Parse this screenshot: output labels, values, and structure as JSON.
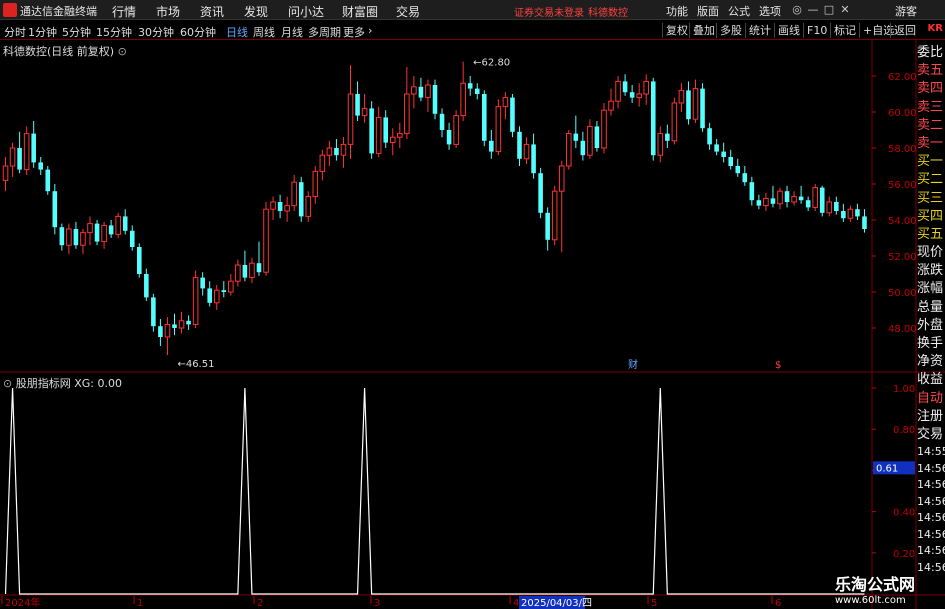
{
  "menubar": {
    "app_title": "通达信金融终端",
    "menus": [
      "行情",
      "市场",
      "资讯",
      "发现",
      "问小达",
      "财富圈",
      "交易"
    ],
    "status_login": "证券交易未登录",
    "status_stock": "科德数控",
    "right_menus": [
      "功能",
      "版面",
      "公式",
      "选项"
    ],
    "guest": "游客",
    "win_buttons": [
      "◎",
      "—",
      "□",
      "✕"
    ]
  },
  "tabs": {
    "items": [
      "分时",
      "1分钟",
      "5分钟",
      "15分钟",
      "30分钟",
      "60分钟",
      "日线",
      "周线",
      "月线",
      "多周期",
      "更多"
    ],
    "active": "日线",
    "more_arrow": "›",
    "right_buttons": [
      "复权",
      "叠加",
      "多股",
      "统计",
      "画线",
      "F10",
      "标记",
      "+自选",
      "返回"
    ],
    "kr": "KR"
  },
  "main_chart": {
    "title": "科德数控(日线 前复权)",
    "y_ticks": [
      "62.00",
      "60.00",
      "58.00",
      "56.00",
      "54.00",
      "52.00",
      "50.00",
      "48.00"
    ],
    "high_label": "62.80",
    "low_label": "46.51",
    "marker_cai": "财",
    "marker_dollar": "$"
  },
  "indicator": {
    "title": "股朋指标网 XG: 0.00",
    "y_ticks": [
      "1.00",
      "0.80",
      "0.60",
      "0.40",
      "0.20"
    ],
    "current_value": "0.61"
  },
  "x_axis": {
    "labels": [
      "2024年",
      "1",
      "2",
      "3",
      "4",
      "5",
      "6"
    ],
    "highlight_date": "2025/04/03/四"
  },
  "side_list": {
    "items": [
      "委比",
      "卖五",
      "卖四",
      "卖三",
      "卖二",
      "卖一",
      "买一",
      "买二",
      "买三",
      "买四",
      "买五",
      "现价",
      "涨跌",
      "涨幅",
      "总量",
      "外盘",
      "换手",
      "净资",
      "收益",
      "自动",
      "注册",
      "交易",
      "14:55",
      "14:56",
      "14:56",
      "14:56",
      "14:56",
      "14:56",
      "14:56",
      "14:56"
    ]
  },
  "watermark": {
    "line1": "乐淘公式网",
    "line2": "www.60lt.com"
  },
  "chart_data": {
    "type": "candlestick",
    "y_range": [
      46.5,
      63.0
    ],
    "candles": [
      {
        "o": 56.2,
        "h": 57.5,
        "l": 55.6,
        "c": 57.0
      },
      {
        "o": 57.0,
        "h": 58.3,
        "l": 56.4,
        "c": 58.0
      },
      {
        "o": 58.0,
        "h": 58.9,
        "l": 56.6,
        "c": 56.8
      },
      {
        "o": 56.8,
        "h": 59.2,
        "l": 56.5,
        "c": 58.8
      },
      {
        "o": 58.8,
        "h": 59.5,
        "l": 56.9,
        "c": 57.2
      },
      {
        "o": 57.2,
        "h": 57.5,
        "l": 56.5,
        "c": 56.8
      },
      {
        "o": 56.8,
        "h": 57.0,
        "l": 55.4,
        "c": 55.6
      },
      {
        "o": 55.6,
        "h": 56.0,
        "l": 53.2,
        "c": 53.6
      },
      {
        "o": 53.6,
        "h": 53.8,
        "l": 52.3,
        "c": 52.6
      },
      {
        "o": 52.6,
        "h": 53.8,
        "l": 52.1,
        "c": 53.5
      },
      {
        "o": 53.5,
        "h": 53.9,
        "l": 52.4,
        "c": 52.6
      },
      {
        "o": 52.6,
        "h": 53.5,
        "l": 52.1,
        "c": 53.3
      },
      {
        "o": 53.3,
        "h": 54.2,
        "l": 52.6,
        "c": 53.8
      },
      {
        "o": 53.8,
        "h": 54.0,
        "l": 52.6,
        "c": 52.8
      },
      {
        "o": 52.8,
        "h": 53.9,
        "l": 52.4,
        "c": 53.7
      },
      {
        "o": 53.7,
        "h": 54.0,
        "l": 53.0,
        "c": 53.2
      },
      {
        "o": 53.2,
        "h": 54.4,
        "l": 53.0,
        "c": 54.2
      },
      {
        "o": 54.2,
        "h": 54.6,
        "l": 53.2,
        "c": 53.4
      },
      {
        "o": 53.4,
        "h": 53.7,
        "l": 52.3,
        "c": 52.5
      },
      {
        "o": 52.5,
        "h": 52.7,
        "l": 50.8,
        "c": 51.0
      },
      {
        "o": 51.0,
        "h": 51.3,
        "l": 49.5,
        "c": 49.7
      },
      {
        "o": 49.7,
        "h": 49.9,
        "l": 47.8,
        "c": 48.1
      },
      {
        "o": 48.1,
        "h": 48.5,
        "l": 47.0,
        "c": 47.5
      },
      {
        "o": 47.5,
        "h": 48.6,
        "l": 46.5,
        "c": 48.2
      },
      {
        "o": 48.2,
        "h": 48.8,
        "l": 47.6,
        "c": 48.0
      },
      {
        "o": 48.0,
        "h": 48.9,
        "l": 47.7,
        "c": 48.4
      },
      {
        "o": 48.4,
        "h": 48.7,
        "l": 47.9,
        "c": 48.2
      },
      {
        "o": 48.2,
        "h": 51.2,
        "l": 48.0,
        "c": 50.8
      },
      {
        "o": 50.8,
        "h": 51.1,
        "l": 49.8,
        "c": 50.2
      },
      {
        "o": 50.2,
        "h": 50.6,
        "l": 49.2,
        "c": 49.4
      },
      {
        "o": 49.4,
        "h": 50.4,
        "l": 49.0,
        "c": 50.1
      },
      {
        "o": 50.1,
        "h": 50.6,
        "l": 49.7,
        "c": 50.0
      },
      {
        "o": 50.0,
        "h": 51.0,
        "l": 49.8,
        "c": 50.6
      },
      {
        "o": 50.6,
        "h": 51.8,
        "l": 50.3,
        "c": 51.5
      },
      {
        "o": 51.5,
        "h": 52.3,
        "l": 50.6,
        "c": 50.8
      },
      {
        "o": 50.8,
        "h": 51.9,
        "l": 50.5,
        "c": 51.6
      },
      {
        "o": 51.6,
        "h": 52.8,
        "l": 50.9,
        "c": 51.1
      },
      {
        "o": 51.1,
        "h": 55.0,
        "l": 50.9,
        "c": 54.6
      },
      {
        "o": 54.6,
        "h": 55.3,
        "l": 54.0,
        "c": 55.0
      },
      {
        "o": 55.0,
        "h": 55.4,
        "l": 54.1,
        "c": 54.5
      },
      {
        "o": 54.5,
        "h": 55.3,
        "l": 53.9,
        "c": 54.8
      },
      {
        "o": 54.8,
        "h": 56.5,
        "l": 54.5,
        "c": 56.1
      },
      {
        "o": 56.1,
        "h": 56.4,
        "l": 53.9,
        "c": 54.2
      },
      {
        "o": 54.2,
        "h": 55.6,
        "l": 53.9,
        "c": 55.3
      },
      {
        "o": 55.3,
        "h": 57.0,
        "l": 54.9,
        "c": 56.7
      },
      {
        "o": 56.7,
        "h": 57.9,
        "l": 56.2,
        "c": 57.6
      },
      {
        "o": 57.6,
        "h": 58.4,
        "l": 57.0,
        "c": 58.0
      },
      {
        "o": 58.0,
        "h": 58.5,
        "l": 57.3,
        "c": 57.6
      },
      {
        "o": 57.6,
        "h": 58.6,
        "l": 56.9,
        "c": 58.2
      },
      {
        "o": 58.2,
        "h": 62.6,
        "l": 57.4,
        "c": 61.0
      },
      {
        "o": 61.0,
        "h": 61.7,
        "l": 59.5,
        "c": 59.8
      },
      {
        "o": 59.8,
        "h": 61.0,
        "l": 59.4,
        "c": 60.2
      },
      {
        "o": 60.2,
        "h": 60.6,
        "l": 57.4,
        "c": 57.7
      },
      {
        "o": 57.7,
        "h": 60.3,
        "l": 57.5,
        "c": 59.7
      },
      {
        "o": 59.7,
        "h": 60.1,
        "l": 58.0,
        "c": 58.3
      },
      {
        "o": 58.3,
        "h": 59.1,
        "l": 57.6,
        "c": 58.6
      },
      {
        "o": 58.6,
        "h": 59.4,
        "l": 58.0,
        "c": 58.8
      },
      {
        "o": 58.8,
        "h": 62.5,
        "l": 58.5,
        "c": 61.0
      },
      {
        "o": 61.0,
        "h": 62.0,
        "l": 60.2,
        "c": 61.4
      },
      {
        "o": 61.4,
        "h": 61.9,
        "l": 60.6,
        "c": 60.8
      },
      {
        "o": 60.8,
        "h": 61.8,
        "l": 60.0,
        "c": 61.5
      },
      {
        "o": 61.5,
        "h": 61.8,
        "l": 59.6,
        "c": 59.9
      },
      {
        "o": 59.9,
        "h": 60.2,
        "l": 58.6,
        "c": 59.0
      },
      {
        "o": 59.0,
        "h": 59.4,
        "l": 57.9,
        "c": 58.2
      },
      {
        "o": 58.2,
        "h": 60.1,
        "l": 58.0,
        "c": 59.8
      },
      {
        "o": 59.8,
        "h": 62.8,
        "l": 59.5,
        "c": 61.6
      },
      {
        "o": 61.6,
        "h": 62.0,
        "l": 60.9,
        "c": 61.3
      },
      {
        "o": 61.3,
        "h": 61.6,
        "l": 60.7,
        "c": 61.0
      },
      {
        "o": 61.0,
        "h": 61.2,
        "l": 58.1,
        "c": 58.4
      },
      {
        "o": 58.4,
        "h": 59.0,
        "l": 57.4,
        "c": 57.8
      },
      {
        "o": 57.8,
        "h": 60.7,
        "l": 57.6,
        "c": 60.3
      },
      {
        "o": 60.3,
        "h": 61.1,
        "l": 59.6,
        "c": 60.8
      },
      {
        "o": 60.8,
        "h": 61.0,
        "l": 58.6,
        "c": 58.9
      },
      {
        "o": 58.9,
        "h": 59.2,
        "l": 57.0,
        "c": 57.4
      },
      {
        "o": 57.4,
        "h": 58.6,
        "l": 57.1,
        "c": 58.2
      },
      {
        "o": 58.2,
        "h": 58.8,
        "l": 56.3,
        "c": 56.6
      },
      {
        "o": 56.6,
        "h": 56.9,
        "l": 54.1,
        "c": 54.4
      },
      {
        "o": 54.4,
        "h": 54.7,
        "l": 52.3,
        "c": 52.9
      },
      {
        "o": 52.9,
        "h": 55.9,
        "l": 52.6,
        "c": 55.6
      },
      {
        "o": 55.6,
        "h": 57.3,
        "l": 52.2,
        "c": 57.0
      },
      {
        "o": 57.0,
        "h": 59.0,
        "l": 56.8,
        "c": 58.8
      },
      {
        "o": 58.8,
        "h": 59.8,
        "l": 58.0,
        "c": 58.4
      },
      {
        "o": 58.4,
        "h": 58.9,
        "l": 57.3,
        "c": 57.6
      },
      {
        "o": 57.6,
        "h": 59.6,
        "l": 57.4,
        "c": 59.2
      },
      {
        "o": 59.2,
        "h": 59.5,
        "l": 57.8,
        "c": 58.0
      },
      {
        "o": 58.0,
        "h": 60.5,
        "l": 57.7,
        "c": 60.1
      },
      {
        "o": 60.1,
        "h": 61.3,
        "l": 59.8,
        "c": 60.6
      },
      {
        "o": 60.6,
        "h": 62.0,
        "l": 60.2,
        "c": 61.7
      },
      {
        "o": 61.7,
        "h": 62.1,
        "l": 60.9,
        "c": 61.1
      },
      {
        "o": 61.1,
        "h": 61.5,
        "l": 60.5,
        "c": 60.8
      },
      {
        "o": 60.8,
        "h": 61.6,
        "l": 60.3,
        "c": 61.0
      },
      {
        "o": 61.0,
        "h": 62.1,
        "l": 60.4,
        "c": 61.7
      },
      {
        "o": 61.7,
        "h": 61.9,
        "l": 57.3,
        "c": 57.6
      },
      {
        "o": 57.6,
        "h": 59.2,
        "l": 57.2,
        "c": 58.8
      },
      {
        "o": 58.8,
        "h": 59.3,
        "l": 58.0,
        "c": 58.4
      },
      {
        "o": 58.4,
        "h": 60.8,
        "l": 58.2,
        "c": 60.5
      },
      {
        "o": 60.5,
        "h": 61.6,
        "l": 60.0,
        "c": 61.2
      },
      {
        "o": 61.2,
        "h": 61.7,
        "l": 59.3,
        "c": 59.6
      },
      {
        "o": 59.6,
        "h": 61.8,
        "l": 59.4,
        "c": 61.3
      },
      {
        "o": 61.3,
        "h": 61.6,
        "l": 58.9,
        "c": 59.1
      },
      {
        "o": 59.1,
        "h": 59.4,
        "l": 57.9,
        "c": 58.2
      },
      {
        "o": 58.2,
        "h": 58.5,
        "l": 57.6,
        "c": 57.8
      },
      {
        "o": 57.8,
        "h": 58.3,
        "l": 57.2,
        "c": 57.5
      },
      {
        "o": 57.5,
        "h": 57.9,
        "l": 56.8,
        "c": 57.0
      },
      {
        "o": 57.0,
        "h": 57.4,
        "l": 56.4,
        "c": 56.6
      },
      {
        "o": 56.6,
        "h": 57.0,
        "l": 55.9,
        "c": 56.1
      },
      {
        "o": 56.1,
        "h": 56.4,
        "l": 54.8,
        "c": 55.1
      },
      {
        "o": 55.1,
        "h": 55.4,
        "l": 54.6,
        "c": 54.8
      },
      {
        "o": 54.8,
        "h": 55.5,
        "l": 54.5,
        "c": 55.2
      },
      {
        "o": 55.2,
        "h": 55.9,
        "l": 54.7,
        "c": 54.9
      },
      {
        "o": 54.9,
        "h": 55.8,
        "l": 54.6,
        "c": 55.6
      },
      {
        "o": 55.6,
        "h": 55.9,
        "l": 54.7,
        "c": 55.0
      },
      {
        "o": 55.0,
        "h": 55.6,
        "l": 54.8,
        "c": 55.3
      },
      {
        "o": 55.3,
        "h": 55.9,
        "l": 54.9,
        "c": 55.1
      },
      {
        "o": 55.1,
        "h": 55.3,
        "l": 54.5,
        "c": 54.7
      },
      {
        "o": 54.7,
        "h": 56.0,
        "l": 54.5,
        "c": 55.8
      },
      {
        "o": 55.8,
        "h": 55.9,
        "l": 54.2,
        "c": 54.4
      },
      {
        "o": 54.4,
        "h": 55.3,
        "l": 54.2,
        "c": 55.0
      },
      {
        "o": 55.0,
        "h": 55.3,
        "l": 54.3,
        "c": 54.5
      },
      {
        "o": 54.5,
        "h": 54.9,
        "l": 53.9,
        "c": 54.1
      },
      {
        "o": 54.1,
        "h": 54.8,
        "l": 53.9,
        "c": 54.6
      },
      {
        "o": 54.6,
        "h": 54.9,
        "l": 54.0,
        "c": 54.2
      },
      {
        "o": 54.2,
        "h": 54.6,
        "l": 53.3,
        "c": 53.5
      }
    ],
    "indicator_series": {
      "name": "XG",
      "spikes_at": [
        1,
        34,
        51,
        93
      ],
      "peak": 1.0
    },
    "colors": {
      "up": "#ff3232",
      "down": "#54ffff",
      "grid": "#7a0000",
      "axis_text": "#c00000"
    }
  }
}
